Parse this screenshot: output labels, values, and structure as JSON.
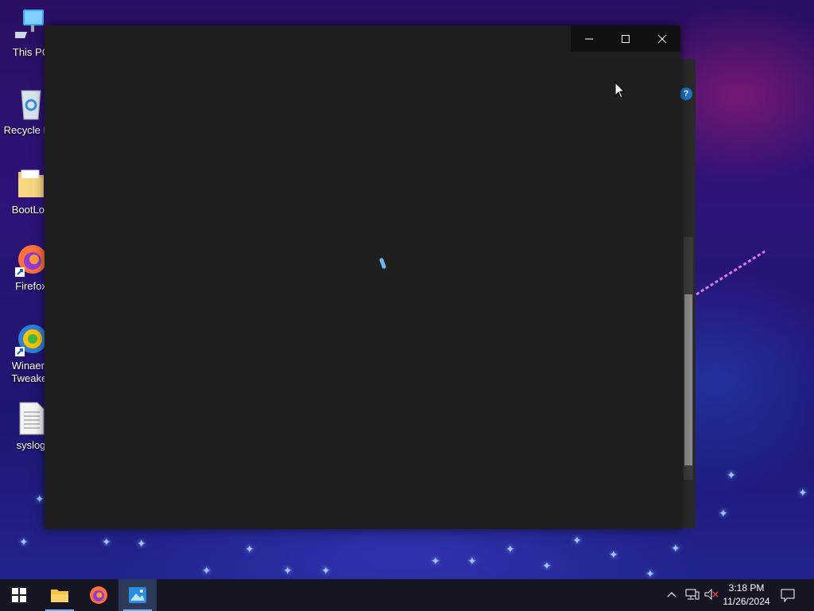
{
  "desktop": {
    "icons": [
      {
        "label": "This PC",
        "icon": "computer-icon"
      },
      {
        "label": "Recycle Bin",
        "icon": "recycle-bin-icon"
      },
      {
        "label": "BootLog",
        "icon": "folder-icon"
      },
      {
        "label": "Firefox",
        "icon": "firefox-icon"
      },
      {
        "label": "Winaero Tweaker",
        "icon": "winaero-tweaker-icon"
      },
      {
        "label": "syslog",
        "icon": "text-file-icon"
      }
    ]
  },
  "window": {
    "state": "loading",
    "spinner_icon": "loading-spinner-icon",
    "caption": {
      "minimize_glyph": "—",
      "maximize_glyph": "☐",
      "close_glyph": "✕"
    }
  },
  "background_window": {
    "help_label": "?"
  },
  "taskbar": {
    "items": [
      {
        "name": "start",
        "icon": "windows-logo-icon"
      },
      {
        "name": "file-explorer",
        "icon": "folder-icon"
      },
      {
        "name": "firefox",
        "icon": "firefox-icon"
      },
      {
        "name": "photos",
        "icon": "photos-icon",
        "active": true
      }
    ],
    "tray": {
      "time": "3:18 PM",
      "date": "11/26/2024"
    }
  },
  "colors": {
    "accent": "#6ab0f3",
    "window_bg": "#1f1f1f",
    "taskbar_bg": "#151524"
  }
}
